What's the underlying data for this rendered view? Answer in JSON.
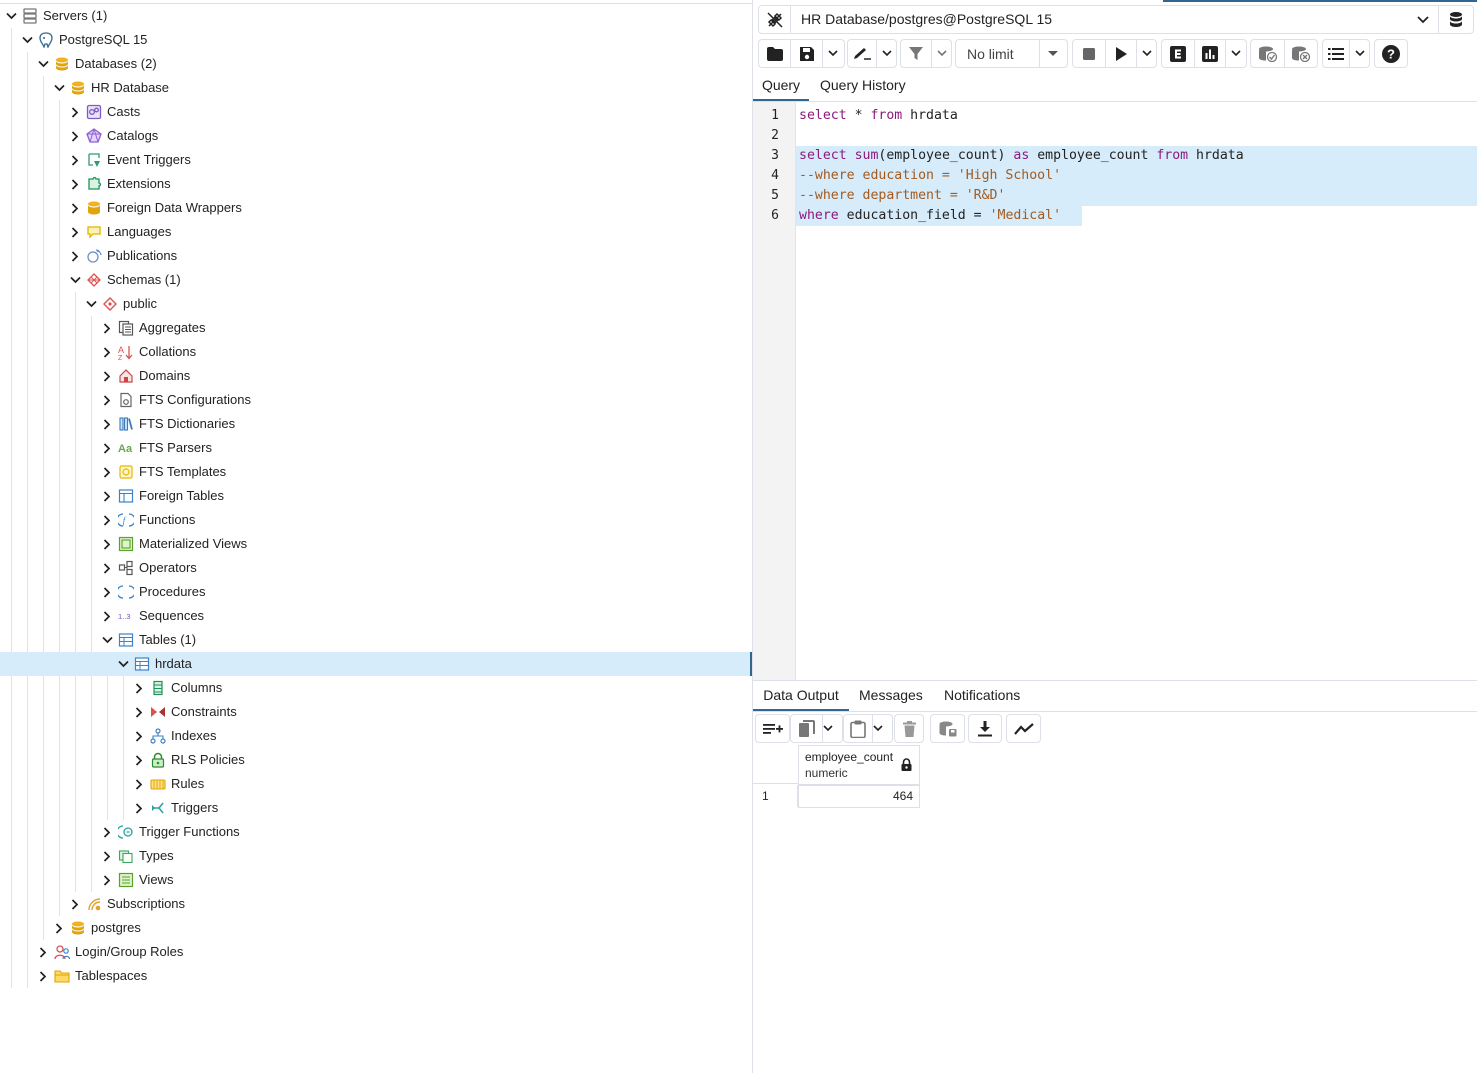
{
  "tree": [
    {
      "label": "Servers (1)",
      "level": 0,
      "expanded": true,
      "icon": "servers-icon"
    },
    {
      "label": "PostgreSQL 15",
      "level": 1,
      "expanded": true,
      "icon": "postgresql-server-icon"
    },
    {
      "label": "Databases (2)",
      "level": 2,
      "expanded": true,
      "icon": "databases-icon"
    },
    {
      "label": "HR Database",
      "level": 3,
      "expanded": true,
      "icon": "database-icon"
    },
    {
      "label": "Casts",
      "level": 4,
      "expanded": false,
      "icon": "casts-icon"
    },
    {
      "label": "Catalogs",
      "level": 4,
      "expanded": false,
      "icon": "catalogs-icon"
    },
    {
      "label": "Event Triggers",
      "level": 4,
      "expanded": false,
      "icon": "event-triggers-icon"
    },
    {
      "label": "Extensions",
      "level": 4,
      "expanded": false,
      "icon": "extensions-icon"
    },
    {
      "label": "Foreign Data Wrappers",
      "level": 4,
      "expanded": false,
      "icon": "foreign-data-wrappers-icon"
    },
    {
      "label": "Languages",
      "level": 4,
      "expanded": false,
      "icon": "languages-icon"
    },
    {
      "label": "Publications",
      "level": 4,
      "expanded": false,
      "icon": "publications-icon"
    },
    {
      "label": "Schemas (1)",
      "level": 4,
      "expanded": true,
      "icon": "schemas-icon"
    },
    {
      "label": "public",
      "level": 5,
      "expanded": true,
      "icon": "schema-public-icon"
    },
    {
      "label": "Aggregates",
      "level": 6,
      "expanded": false,
      "icon": "aggregates-icon"
    },
    {
      "label": "Collations",
      "level": 6,
      "expanded": false,
      "icon": "collations-icon"
    },
    {
      "label": "Domains",
      "level": 6,
      "expanded": false,
      "icon": "domains-icon"
    },
    {
      "label": "FTS Configurations",
      "level": 6,
      "expanded": false,
      "icon": "fts-configurations-icon"
    },
    {
      "label": "FTS Dictionaries",
      "level": 6,
      "expanded": false,
      "icon": "fts-dictionaries-icon"
    },
    {
      "label": "FTS Parsers",
      "level": 6,
      "expanded": false,
      "icon": "fts-parsers-icon"
    },
    {
      "label": "FTS Templates",
      "level": 6,
      "expanded": false,
      "icon": "fts-templates-icon"
    },
    {
      "label": "Foreign Tables",
      "level": 6,
      "expanded": false,
      "icon": "foreign-tables-icon"
    },
    {
      "label": "Functions",
      "level": 6,
      "expanded": false,
      "icon": "functions-icon"
    },
    {
      "label": "Materialized Views",
      "level": 6,
      "expanded": false,
      "icon": "materialized-views-icon"
    },
    {
      "label": "Operators",
      "level": 6,
      "expanded": false,
      "icon": "operators-icon"
    },
    {
      "label": "Procedures",
      "level": 6,
      "expanded": false,
      "icon": "procedures-icon"
    },
    {
      "label": "Sequences",
      "level": 6,
      "expanded": false,
      "icon": "sequences-icon"
    },
    {
      "label": "Tables (1)",
      "level": 6,
      "expanded": true,
      "icon": "tables-icon"
    },
    {
      "label": "hrdata",
      "level": 7,
      "expanded": true,
      "icon": "table-icon",
      "selected": true
    },
    {
      "label": "Columns",
      "level": 8,
      "expanded": false,
      "icon": "columns-icon"
    },
    {
      "label": "Constraints",
      "level": 8,
      "expanded": false,
      "icon": "constraints-icon"
    },
    {
      "label": "Indexes",
      "level": 8,
      "expanded": false,
      "icon": "indexes-icon"
    },
    {
      "label": "RLS Policies",
      "level": 8,
      "expanded": false,
      "icon": "rls-policies-icon"
    },
    {
      "label": "Rules",
      "level": 8,
      "expanded": false,
      "icon": "rules-icon"
    },
    {
      "label": "Triggers",
      "level": 8,
      "expanded": false,
      "icon": "triggers-icon"
    },
    {
      "label": "Trigger Functions",
      "level": 6,
      "expanded": false,
      "icon": "trigger-functions-icon"
    },
    {
      "label": "Types",
      "level": 6,
      "expanded": false,
      "icon": "types-icon"
    },
    {
      "label": "Views",
      "level": 6,
      "expanded": false,
      "icon": "views-icon"
    },
    {
      "label": "Subscriptions",
      "level": 4,
      "expanded": false,
      "icon": "subscriptions-icon"
    },
    {
      "label": "postgres",
      "level": 3,
      "expanded": false,
      "icon": "database-icon"
    },
    {
      "label": "Login/Group Roles",
      "level": 2,
      "expanded": false,
      "icon": "login-roles-icon"
    },
    {
      "label": "Tablespaces",
      "level": 2,
      "expanded": false,
      "icon": "tablespaces-icon"
    }
  ],
  "connection": {
    "label": "HR Database/postgres@PostgreSQL 15"
  },
  "toolbar": {
    "limit_label": "No limit"
  },
  "editor_tabs": {
    "query": "Query",
    "history": "Query History"
  },
  "editor": {
    "line_numbers": [
      "1",
      "2",
      "3",
      "4",
      "5",
      "6"
    ],
    "lines": [
      [
        {
          "t": "select",
          "c": "kw"
        },
        {
          "t": " * ",
          "c": "id"
        },
        {
          "t": "from",
          "c": "kw"
        },
        {
          "t": " hrdata",
          "c": "id"
        }
      ],
      [],
      [
        {
          "t": "select",
          "c": "kw"
        },
        {
          "t": " ",
          "c": "id"
        },
        {
          "t": "sum",
          "c": "fn"
        },
        {
          "t": "(employee_count) ",
          "c": "id"
        },
        {
          "t": "as",
          "c": "kw"
        },
        {
          "t": " employee_count ",
          "c": "id"
        },
        {
          "t": "from",
          "c": "kw"
        },
        {
          "t": " hrdata",
          "c": "id"
        }
      ],
      [
        {
          "t": "--where education = 'High School'",
          "c": "cm"
        }
      ],
      [
        {
          "t": "--where department = 'R&D'",
          "c": "cm"
        }
      ],
      [
        {
          "t": "where",
          "c": "kw"
        },
        {
          "t": " education_field = ",
          "c": "id"
        },
        {
          "t": "'Medical'",
          "c": "str"
        }
      ]
    ]
  },
  "output_tabs": {
    "data": "Data Output",
    "messages": "Messages",
    "notifications": "Notifications"
  },
  "result": {
    "column_name": "employee_count",
    "column_type": "numeric",
    "rows": [
      {
        "num": "1",
        "value": "464"
      }
    ]
  },
  "colors": {
    "accent": "#326690",
    "selection": "#d6ecfa",
    "keyword": "#8b1a7c",
    "string": "#a35a1f"
  }
}
